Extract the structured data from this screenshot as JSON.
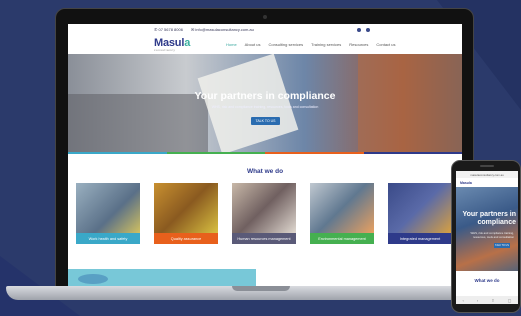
{
  "site": {
    "logo_main": "Masul",
    "logo_accent": "a",
    "logo_sub": "consultancy",
    "topbar": {
      "phone": "07 5678 8006",
      "email": "info@masulaconsultancy.com.au"
    },
    "menu": [
      "Home",
      "About us",
      "Consulting services",
      "Training services",
      "Resources",
      "Contact us"
    ],
    "hero": {
      "title": "Your partners in compliance",
      "subtitle": "WHS, risk and compliance training, resources, tools and consultation",
      "button": "TALK TO US"
    },
    "section_title": "What we do",
    "cards": [
      {
        "label": "Work health and safety",
        "color": "#3aa8c8"
      },
      {
        "label": "Quality assurance",
        "color": "#e8601c"
      },
      {
        "label": "Human resources management",
        "color": "#5a5a78"
      },
      {
        "label": "Environmental management",
        "color": "#45b050"
      },
      {
        "label": "Integrated management",
        "color": "#2e3a8a"
      }
    ],
    "stripe_colors": [
      "#3aa8c8",
      "#45b050",
      "#e8601c",
      "#2e3a8a"
    ]
  },
  "phone": {
    "url": "masulaconsultancy.com.au",
    "logo": "Masula",
    "hero_title": "Your partners in compliance",
    "hero_sub": "WHS, risk and compliance training, resources, tools and consultation",
    "hero_button": "TALK TO US",
    "section_title": "What we do"
  },
  "icons": [
    "phone-icon",
    "email-icon",
    "facebook-icon",
    "linkedin-icon"
  ]
}
